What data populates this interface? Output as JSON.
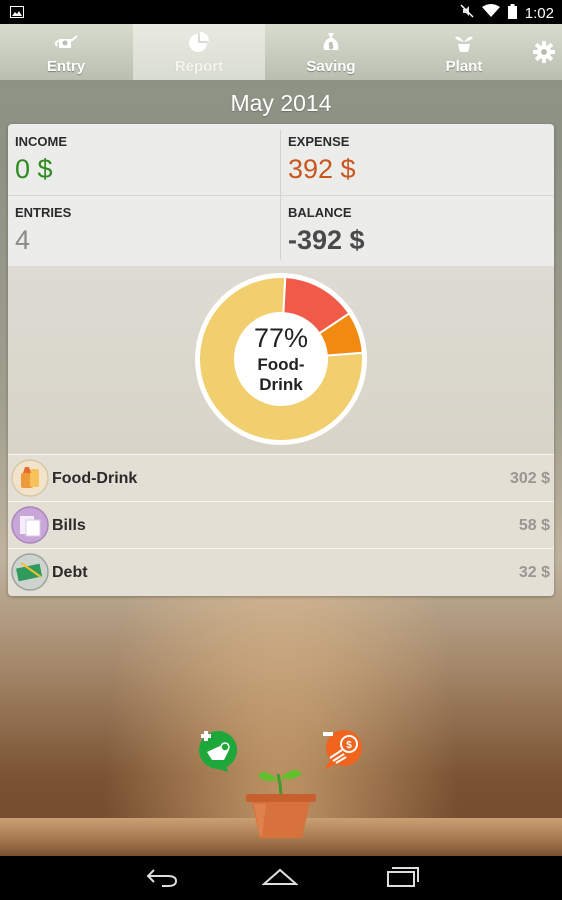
{
  "status_bar": {
    "time": "1:02"
  },
  "tabs": [
    {
      "label": "Entry",
      "icon": "watering-can-icon",
      "active": false
    },
    {
      "label": "Report",
      "icon": "pie-chart-icon",
      "active": true
    },
    {
      "label": "Saving",
      "icon": "money-bag-icon",
      "active": false
    },
    {
      "label": "Plant",
      "icon": "sprout-icon",
      "active": false
    }
  ],
  "month": "May 2014",
  "summary": {
    "income_label": "INCOME",
    "income_value": "0 $",
    "expense_label": "EXPENSE",
    "expense_value": "392 $",
    "entries_label": "ENTRIES",
    "entries_value": "4",
    "balance_label": "BALANCE",
    "balance_value": "-392 $"
  },
  "colors": {
    "income": "#2e8b1f",
    "expense": "#c9561d",
    "entries": "#8a8a8a",
    "balance": "#4a4a4a"
  },
  "chart_data": {
    "type": "pie",
    "categories": [
      "Food-Drink",
      "Bills",
      "Debt"
    ],
    "values": [
      302,
      58,
      32
    ],
    "colors": [
      "#f2cf6e",
      "#f05a48",
      "#f08a10"
    ],
    "center_percent": "77%",
    "center_label_line1": "Food-",
    "center_label_line2": "Drink"
  },
  "categories": [
    {
      "name": "Food-Drink",
      "amount": "302 $",
      "icon": "food-drink-icon"
    },
    {
      "name": "Bills",
      "amount": "58 $",
      "icon": "bills-icon"
    },
    {
      "name": "Debt",
      "amount": "32 $",
      "icon": "debt-icon"
    }
  ],
  "plant_actions": {
    "add_income": "add-income-icon",
    "add_expense": "add-expense-icon"
  }
}
